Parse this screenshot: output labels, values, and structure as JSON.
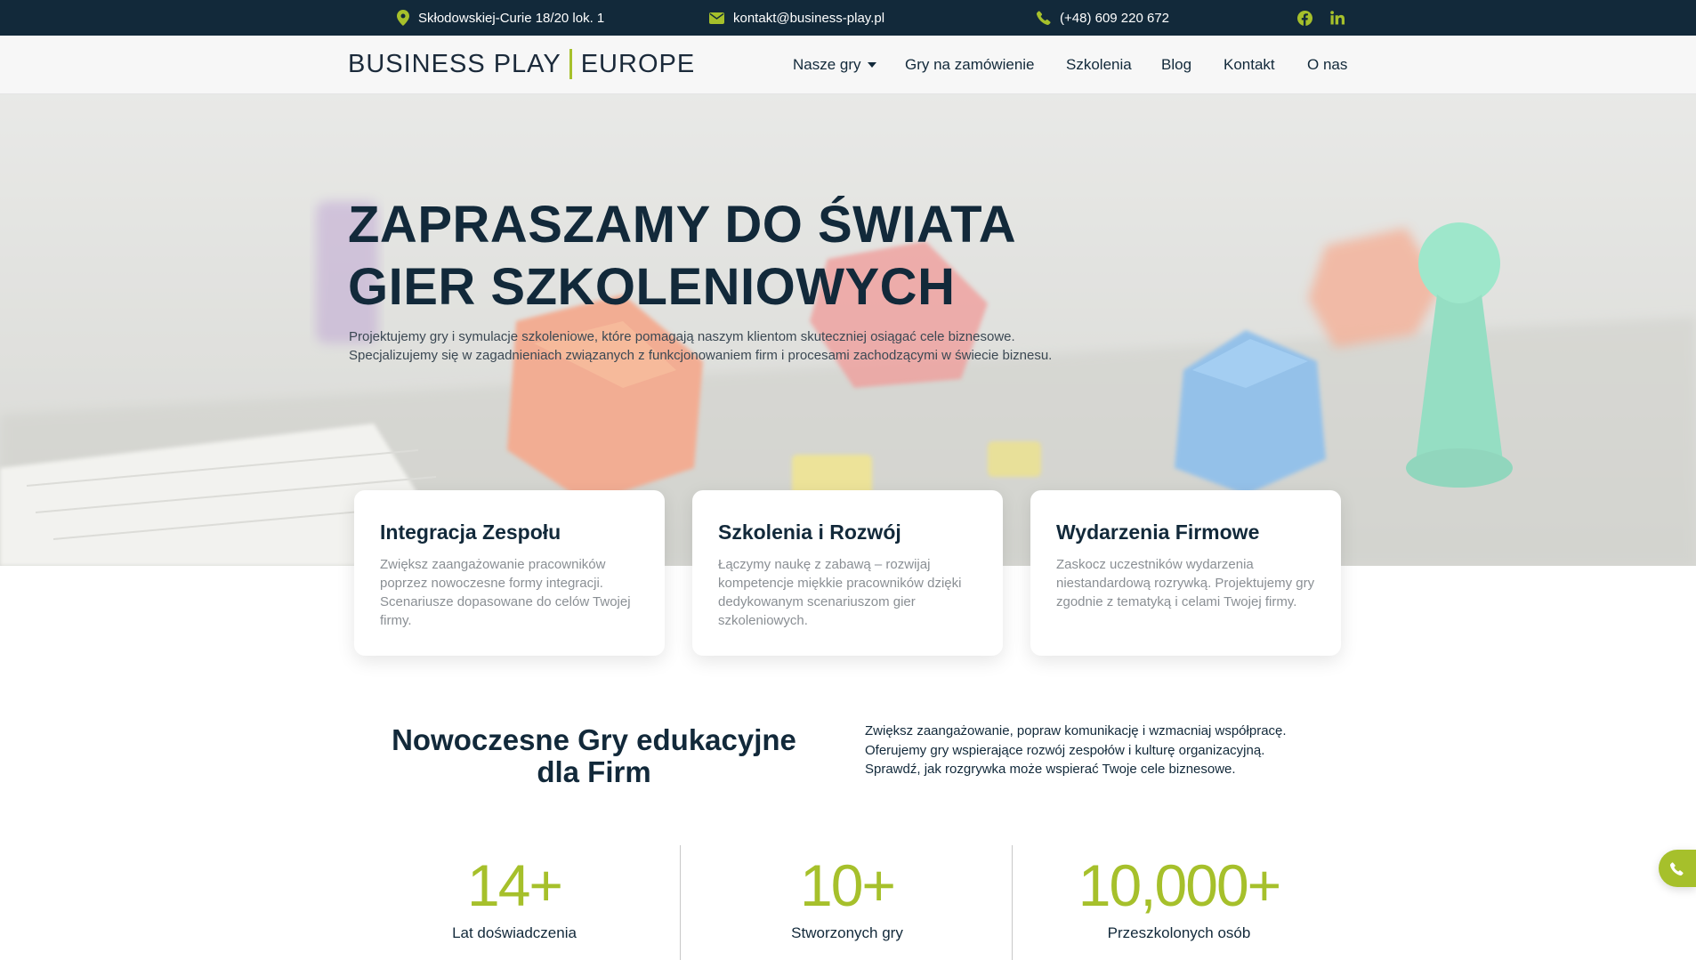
{
  "topbar": {
    "address": "Skłodowskiej-Curie 18/20 lok. 1",
    "email": "kontakt@business-play.pl",
    "phone": "(+48) 609 220 672",
    "social_icons": [
      "facebook-icon",
      "linkedin-icon"
    ]
  },
  "header": {
    "logo_left": "BUSINESS PLAY",
    "logo_right": "EUROPE",
    "nav": [
      {
        "label": "Nasze gry",
        "dropdown": true
      },
      {
        "label": "Gry na zamówienie"
      },
      {
        "label": "Szkolenia"
      },
      {
        "label": "Blog"
      },
      {
        "label": "Kontakt"
      },
      {
        "label": "O nas"
      }
    ]
  },
  "hero": {
    "title_line1": "ZAPRASZAMY DO ŚWIATA",
    "title_line2": "GIER SZKOLENIOWYCH",
    "desc_line1": "Projektujemy gry i symulacje szkoleniowe, które pomagają naszym klientom skuteczniej osiągać cele biznesowe.",
    "desc_line2": "Specjalizujemy się w zagadnieniach związanych z funkcjonowaniem firm i procesami zachodzącymi w świecie biznesu."
  },
  "cards": [
    {
      "title": "Integracja Zespołu",
      "text": "Zwiększ zaangażowanie pracowników poprzez nowoczesne formy integracji. Scenariusze dopasowane do celów Twojej firmy."
    },
    {
      "title": "Szkolenia i Rozwój",
      "text": "Łączymy naukę z zabawą – rozwijaj kompetencje miękkie pracowników dzięki dedykowanym scenariuszom gier szkoleniowych."
    },
    {
      "title": "Wydarzenia Firmowe",
      "text": "Zaskocz uczestników wydarzenia niestandardową rozrywką. Projektujemy gry zgodnie z tematyką i celami Twojej firmy."
    }
  ],
  "section": {
    "title_line1": "Nowoczesne Gry edukacyjne",
    "title_line2": "dla Firm",
    "desc_line1": "Zwiększ zaangażowanie, popraw komunikację i wzmacniaj współpracę.",
    "desc_line2": "Oferujemy gry wspierające rozwój zespołów i kulturę organizacyjną.",
    "desc_line3": "Sprawdź, jak rozgrywka może wspierać Twoje cele biznesowe."
  },
  "stats": [
    {
      "value": "14+",
      "label": "Lat doświadczenia"
    },
    {
      "value": "10+",
      "label": "Stworzonych gry"
    },
    {
      "value": "10,000+",
      "label": "Przeszkolonych osób"
    }
  ],
  "colors": {
    "dark": "#12293a",
    "accent": "#a6c02b",
    "muted": "#8a8f94"
  },
  "floating_button_icon": "phone-icon"
}
